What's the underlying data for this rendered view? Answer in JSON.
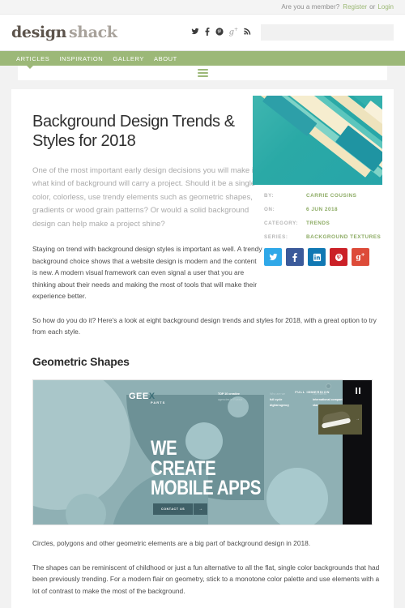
{
  "topbar": {
    "member_text": "Are you a member?",
    "register": "Register",
    "or": "or",
    "login": "Login"
  },
  "masthead": {
    "logo_first": "design",
    "logo_second": "shack",
    "social": [
      "twitter-icon",
      "facebook-icon",
      "pinterest-icon",
      "googleplus-icon",
      "rss-icon"
    ],
    "search_placeholder": "",
    "search_value": ""
  },
  "nav": {
    "items": [
      "ARTICLES",
      "INSPIRATION",
      "GALLERY",
      "ABOUT"
    ],
    "active": "ARTICLES"
  },
  "strip": {
    "menu_icon": "hamburger-icon"
  },
  "article": {
    "title": "Background Design Trends & Styles for 2018",
    "lede": "One of the most important early design decisions you will make is what kind of background will carry a project. Should it be a single color, colorless, use trendy elements such as geometric shapes, gradients or wood grain patterns? Or would a solid background design can help make a project shine?",
    "para2": "Staying on trend with background design styles is important as well. A trendy background choice shows that a website design is modern and the content is new. A modern visual framework can even signal a user that you are thinking about their needs and making the most of tools that will make their experience better.",
    "para3": "So how do you do it? Here's a look at eight background design trends and styles for 2018, with a great option to try from each style.",
    "section_heading": "Geometric Shapes",
    "para4": "Circles, polygons and other geometric elements are a big part of background design in 2018.",
    "para5": "The shapes can be reminiscent of childhood or just a fun alternative to all the flat, single color backgrounds that had been previously trending. For a modern flair on geometry, stick to a monotone color palette and use elements with a lot of contrast to make the most of the background."
  },
  "meta": {
    "rows": [
      {
        "label": "BY:",
        "value": "CARRIE COUSINS"
      },
      {
        "label": "ON:",
        "value": "6 JUN 2018"
      },
      {
        "label": "CATEGORY:",
        "value": "TRENDS"
      },
      {
        "label": "SERIES:",
        "value": "BACKGROUND TEXTURES"
      }
    ],
    "share_buttons": [
      {
        "name": "twitter-share-button",
        "glyph": "twitter-icon",
        "color": "#2fa8e8"
      },
      {
        "name": "facebook-share-button",
        "glyph": "facebook-icon",
        "color": "#3b5a9a"
      },
      {
        "name": "linkedin-share-button",
        "glyph": "linkedin-icon",
        "color": "#1178b3"
      },
      {
        "name": "pinterest-share-button",
        "glyph": "pinterest-icon",
        "color": "#cb2027"
      },
      {
        "name": "googleplus-share-button",
        "glyph": "googleplus-icon",
        "color": "#dd4b39"
      }
    ]
  },
  "embed": {
    "logo_main": "GEE",
    "logo_accent": "X",
    "logo_sub": "PARTS",
    "nav_col1_dim": "TOP 10 creative",
    "nav_col1_hi": "agencies in Russia",
    "nav_col2_dim": "Who are we",
    "nav_col2_hi1": "full cycle",
    "nav_col2_hi2": "digital agency",
    "nav_col3_dim": "Our clients",
    "nav_col3_hi1": "international companies",
    "nav_col3_hi2": "startups",
    "headline_line1": "WE",
    "headline_line2": "CREATE",
    "headline_line3": "MOBILE APPS",
    "cta_label": "CONTACT US",
    "cta_arrow": "→",
    "full_immersion": "FULL IMMERSION",
    "pause_icon": "pause-icon",
    "thumb_arrow": "→"
  },
  "colors": {
    "nav_green": "#9cb878",
    "accent_green": "#8cab63",
    "hero_teal": "#2aa9a6",
    "embed_teal": "#8fb0b4"
  }
}
